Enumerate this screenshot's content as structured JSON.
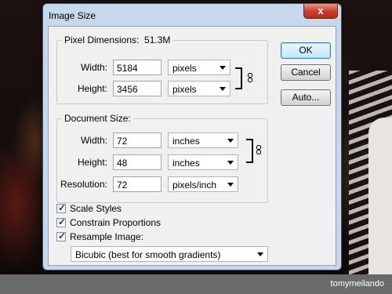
{
  "window": {
    "title": "Image Size",
    "close_glyph": "x"
  },
  "pixel_dimensions": {
    "heading": "Pixel Dimensions:",
    "size": "51.3M",
    "width": {
      "label": "Width:",
      "value": "5184",
      "unit": "pixels"
    },
    "height": {
      "label": "Height:",
      "value": "3456",
      "unit": "pixels"
    }
  },
  "document_size": {
    "heading": "Document Size:",
    "width": {
      "label": "Width:",
      "value": "72",
      "unit": "inches"
    },
    "height": {
      "label": "Height:",
      "value": "48",
      "unit": "inches"
    },
    "resolution": {
      "label": "Resolution:",
      "value": "72",
      "unit": "pixels/inch"
    }
  },
  "options": {
    "scale_styles": {
      "label": "Scale Styles",
      "checked": true
    },
    "constrain_proportions": {
      "label": "Constrain Proportions",
      "checked": true
    },
    "resample_image": {
      "label": "Resample Image:",
      "checked": true
    },
    "resample_method": "Bicubic (best for smooth gradients)"
  },
  "buttons": {
    "ok": "OK",
    "cancel": "Cancel",
    "auto": "Auto..."
  },
  "footer": {
    "credit": "tomymeilando"
  },
  "icons": {
    "link": "chain-link-icon"
  }
}
